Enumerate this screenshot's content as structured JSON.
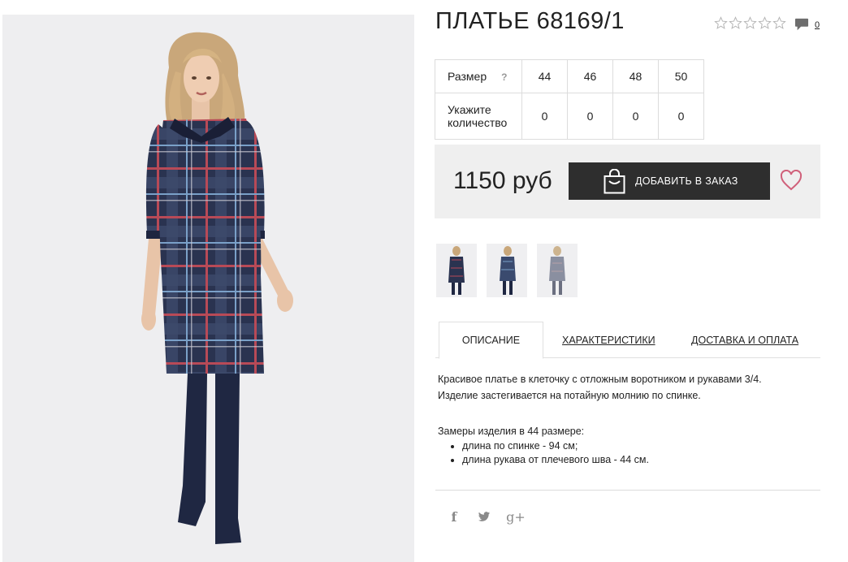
{
  "product": {
    "title": "ПЛАТЬЕ 68169/1",
    "rating_stars": 0,
    "rating_max": 5,
    "comments_count": "0",
    "photo_icon": "model-wearing-plaid-dress-photo"
  },
  "sizes": {
    "size_label": "Размер",
    "help_label": "?",
    "qty_label_line1": "Укажите",
    "qty_label_line2": "количество",
    "columns": [
      "44",
      "46",
      "48",
      "50"
    ],
    "quantities": [
      "0",
      "0",
      "0",
      "0"
    ]
  },
  "buy": {
    "price": "1150 руб",
    "add_button_label": "ДОБАВИТЬ В ЗАКАЗ",
    "bag_icon": "shopping-bag-icon",
    "wishlist_icon": "heart-icon"
  },
  "colors": {
    "accent": "#d0607a",
    "button_bg": "#2e2e2e",
    "buybox_bg": "#efefef",
    "dress_navy": "#2a3350",
    "dress_red": "#b84a57"
  },
  "tabs": [
    {
      "label": "ОПИСАНИЕ",
      "active": true
    },
    {
      "label": "ХАРАКТЕРИСТИКИ",
      "active": false
    },
    {
      "label": "ДОСТАВКА И ОПЛАТА",
      "active": false
    }
  ],
  "description": {
    "line1": "Красивое платье в клеточку с отложным воротником и рукавами 3/4.",
    "line2": "Изделие застегивается на потайную молнию по спинке.",
    "measurements_title": "Замеры изделия в 44 размере:",
    "measurements": [
      "длина по спинке - 94 см;",
      "длина рукава от плечевого шва - 44 см."
    ]
  },
  "social": {
    "facebook": "f",
    "twitter_icon": "twitter-bird-icon",
    "googleplus": "g+"
  }
}
